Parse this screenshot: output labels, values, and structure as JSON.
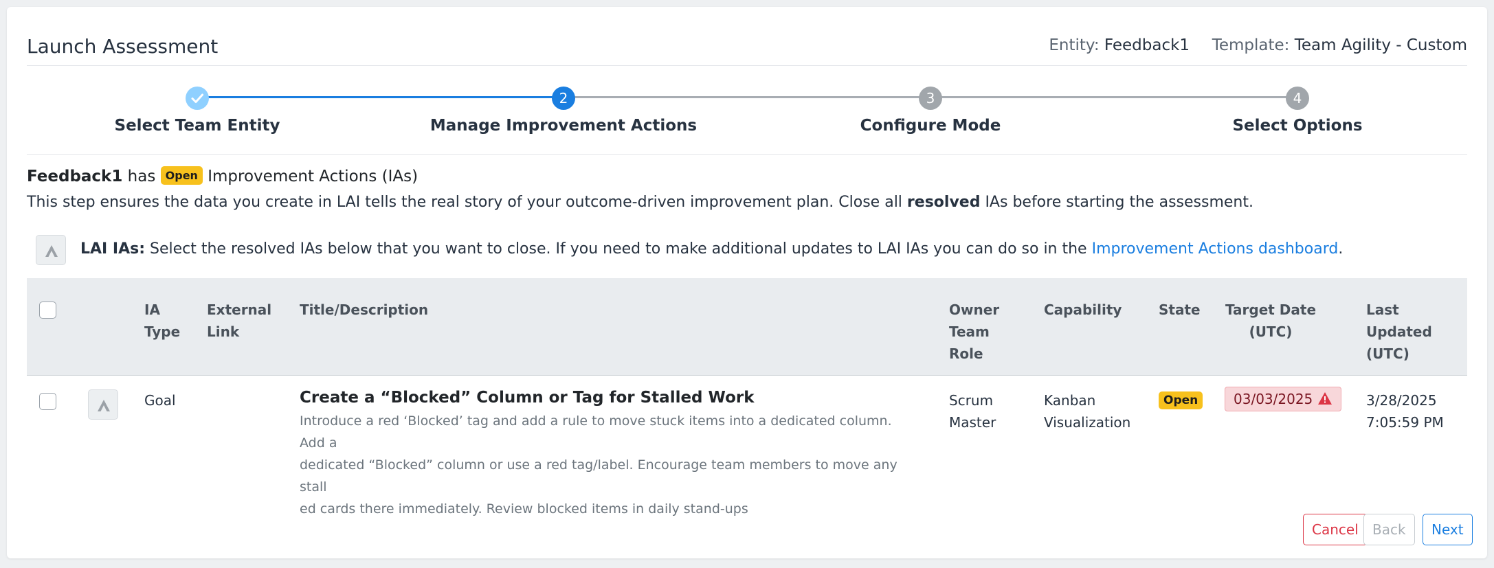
{
  "header": {
    "title": "Launch Assessment",
    "entity_label": "Entity:",
    "entity_value": "Feedback1",
    "template_label": "Template:",
    "template_value": "Team Agility - Custom"
  },
  "stepper": {
    "steps": [
      {
        "label": "Select Team Entity",
        "number": "1",
        "status": "done"
      },
      {
        "label": "Manage Improvement Actions",
        "number": "2",
        "status": "active"
      },
      {
        "label": "Configure Mode",
        "number": "3",
        "status": "todo"
      },
      {
        "label": "Select Options",
        "number": "4",
        "status": "todo"
      }
    ]
  },
  "intro": {
    "entity": "Feedback1",
    "has": " has ",
    "badge": "Open",
    "suffix": " Improvement Actions (IAs)",
    "line2_a": "This step ensures the data you create in LAI tells the real story of your outcome-driven improvement plan. Close all ",
    "line2_bold": "resolved",
    "line2_b": " IAs before starting the assessment."
  },
  "lai": {
    "label": "LAI IAs:",
    "text": " Select the resolved IAs below that you want to close. If you need to make additional updates to LAI IAs you can do so in the ",
    "link": "Improvement Actions dashboard",
    "period": "."
  },
  "table": {
    "headers": {
      "ia_type": [
        "IA",
        "Type"
      ],
      "external_link": [
        "External",
        "Link"
      ],
      "title": "Title/Description",
      "owner": [
        "Owner",
        "Team",
        "Role"
      ],
      "capability": "Capability",
      "state": "State",
      "target_date": [
        "Target Date",
        "(UTC)"
      ],
      "last_updated": [
        "Last",
        "Updated",
        "(UTC)"
      ]
    },
    "rows": [
      {
        "ia_type": "Goal",
        "title": "Create a “Blocked” Column or Tag for Stalled Work",
        "description": [
          "Introduce a red ‘Blocked’ tag and add a rule to move stuck items into a dedicated column. Add a",
          "dedicated “Blocked” column or use a red tag/label. Encourage team members to move any stall",
          "ed cards there immediately. Review blocked items in daily stand-ups"
        ],
        "owner": [
          "Scrum",
          "Master"
        ],
        "capability": [
          "Kanban",
          "Visualization"
        ],
        "state": "Open",
        "target_date": "03/03/2025",
        "last_updated": [
          "3/28/2025",
          "7:05:59 PM"
        ]
      }
    ]
  },
  "buttons": {
    "cancel": "Cancel",
    "back": "Back",
    "next": "Next"
  },
  "colors": {
    "accent": "#1a7ee0",
    "badge": "#f7c11d",
    "danger": "#dc3545",
    "overdue_bg": "#f8d7da"
  },
  "icons": {
    "step_done": "check-icon",
    "lai_logo": "lai-logo-icon",
    "overdue": "warning-triangle-icon"
  }
}
